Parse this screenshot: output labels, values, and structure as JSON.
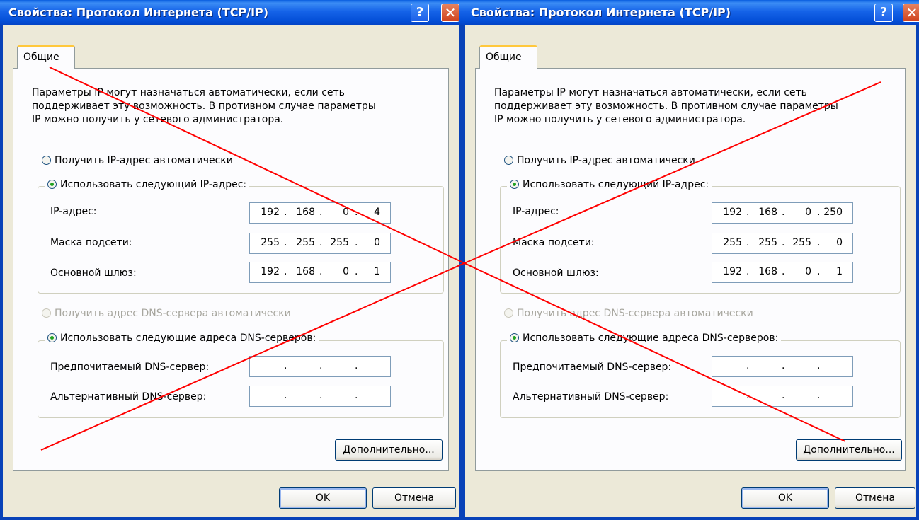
{
  "dialogs": [
    {
      "title": "Свойства: Протокол Интернета (TCP/IP)",
      "tab_label": "Общие",
      "intro": "Параметры IP могут назначаться автоматически, если сеть\nподдерживает эту возможность. В противном случае параметры\nIP можно получить у сетевого администратора.",
      "ip_auto_label": "Получить IP-адрес автоматически",
      "ip_manual_label": "Использовать следующий IP-адрес:",
      "ip_address_label": "IP-адрес:",
      "ip_address": [
        "192",
        "168",
        "0",
        "4"
      ],
      "subnet_label": "Маска подсети:",
      "subnet": [
        "255",
        "255",
        "255",
        "0"
      ],
      "gateway_label": "Основной шлюз:",
      "gateway": [
        "192",
        "168",
        "0",
        "1"
      ],
      "dns_auto_label": "Получить адрес DNS-сервера автоматически",
      "dns_manual_label": "Использовать следующие адреса DNS-серверов:",
      "preferred_dns_label": "Предпочитаемый DNS-сервер:",
      "preferred_dns": [
        "",
        "",
        "",
        ""
      ],
      "alternate_dns_label": "Альтернативный DNS-сервер:",
      "alternate_dns": [
        "",
        "",
        "",
        ""
      ],
      "advanced_button": "Дополнительно...",
      "ok_button": "OK",
      "cancel_button": "Отмена"
    },
    {
      "title": "Свойства: Протокол Интернета (TCP/IP)",
      "tab_label": "Общие",
      "intro": "Параметры IP могут назначаться автоматически, если сеть\nподдерживает эту возможность. В противном случае параметры\nIP можно получить у сетевого администратора.",
      "ip_auto_label": "Получить IP-адрес автоматически",
      "ip_manual_label": "Использовать следующий IP-адрес:",
      "ip_address_label": "IP-адрес:",
      "ip_address": [
        "192",
        "168",
        "0",
        "250"
      ],
      "subnet_label": "Маска подсети:",
      "subnet": [
        "255",
        "255",
        "255",
        "0"
      ],
      "gateway_label": "Основной шлюз:",
      "gateway": [
        "192",
        "168",
        "0",
        "1"
      ],
      "dns_auto_label": "Получить адрес DNS-сервера автоматически",
      "dns_manual_label": "Использовать следующие адреса DNS-серверов:",
      "preferred_dns_label": "Предпочитаемый DNS-сервер:",
      "preferred_dns": [
        "",
        "",
        "",
        ""
      ],
      "alternate_dns_label": "Альтернативный DNS-сервер:",
      "alternate_dns": [
        "",
        "",
        "",
        ""
      ],
      "advanced_button": "Дополнительно...",
      "ok_button": "OK",
      "cancel_button": "Отмена"
    }
  ],
  "title_buttons": {
    "help_icon": "help-icon",
    "close_icon": "close-icon",
    "help_glyph": "?",
    "close_glyph": "✕"
  },
  "colors": {
    "title_bar": "#0550d8",
    "window_bg": "#ece9d8",
    "annotation_cross": "#ff0000",
    "radio_dot": "#21a121"
  }
}
